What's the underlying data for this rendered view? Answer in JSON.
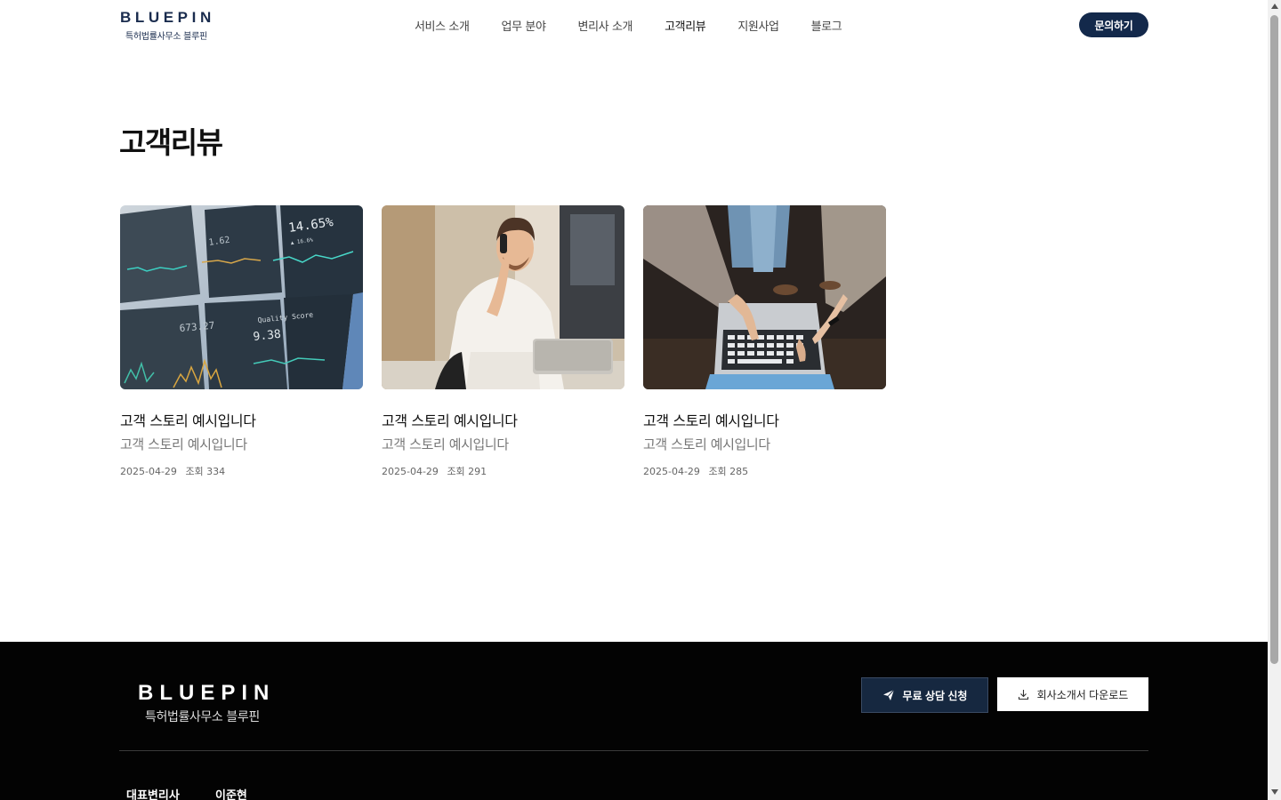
{
  "header": {
    "logo_main": "BLUEPIN",
    "logo_sub": "특허법률사무소 블루핀",
    "nav": [
      {
        "label": "서비스 소개",
        "active": false
      },
      {
        "label": "업무 분야",
        "active": false
      },
      {
        "label": "변리사 소개",
        "active": false
      },
      {
        "label": "고객리뷰",
        "active": true
      },
      {
        "label": "지원사업",
        "active": false
      },
      {
        "label": "블로그",
        "active": false
      }
    ],
    "cta_label": "문의하기"
  },
  "page": {
    "title": "고객리뷰"
  },
  "cards": [
    {
      "image": "stock-dashboard-photo",
      "title": "고객 스토리 예시입니다",
      "subtitle": "고객 스토리 예시입니다",
      "date": "2025-04-29",
      "views": "조회 334"
    },
    {
      "image": "man-on-phone-photo",
      "title": "고객 스토리 예시입니다",
      "subtitle": "고객 스토리 예시입니다",
      "date": "2025-04-29",
      "views": "조회 291"
    },
    {
      "image": "team-laptop-photo",
      "title": "고객 스토리 예시입니다",
      "subtitle": "고객 스토리 예시입니다",
      "date": "2025-04-29",
      "views": "조회 285"
    }
  ],
  "footer": {
    "logo_main": "BLUEPIN",
    "logo_sub": "특허법률사무소 블루핀",
    "consult_label": "무료 상담 신청",
    "download_label": "회사소개서 다운로드",
    "rep_label": "대표변리사",
    "rep_name": "이준현"
  },
  "colors": {
    "brand_navy": "#13294b",
    "footer_bg": "#030303"
  }
}
